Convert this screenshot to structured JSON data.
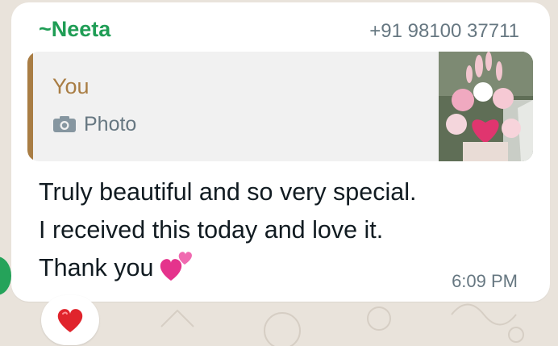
{
  "message": {
    "sender": "~Neeta",
    "phone": "+91 98100 37711",
    "quoted": {
      "author": "You",
      "media_icon": "camera-icon",
      "media_type": "Photo"
    },
    "text": "Truly beautiful and so very special.\nI received this today and love it.\nThank you",
    "emoji": "two-hearts-icon",
    "time": "6:09 PM",
    "reaction": "red-heart-icon"
  },
  "colors": {
    "sender": "#1f9d55",
    "quote_accent": "#a97d44",
    "meta": "#667781",
    "background": "#e9e3db",
    "bubble": "#ffffff"
  }
}
